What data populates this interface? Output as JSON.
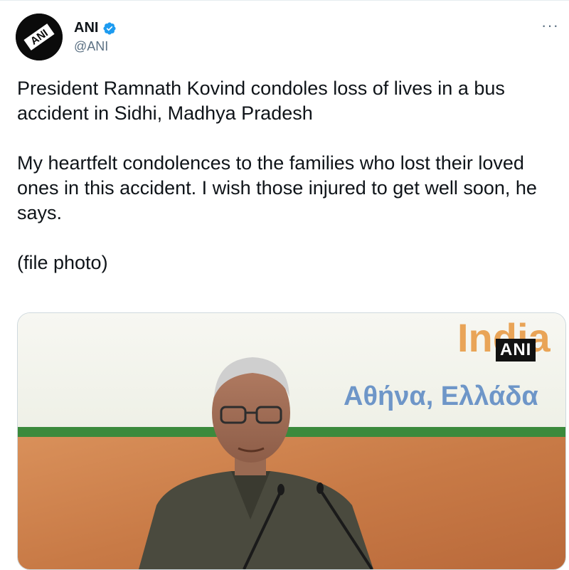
{
  "author": {
    "name": "ANI",
    "handle": "@ANI",
    "avatar_text": "ANI"
  },
  "icons": {
    "verified": "verified-badge-icon",
    "more": "more-options-icon"
  },
  "more_label": "···",
  "tweet": {
    "paragraphs": [
      "President Ramnath Kovind condoles loss of lives in a bus accident in Sidhi, Madhya Pradesh",
      "My heartfelt condolences to the families who lost their loved ones in this accident. I wish those injured to get well soon, he says.",
      "(file photo)"
    ]
  },
  "media": {
    "watermark": "ANI",
    "banner_text": "India",
    "banner_subtext": "Αθήνα, Ελλάδα"
  },
  "colors": {
    "verified": "#1d9bf0",
    "banner_orange": "#e9a457",
    "banner_blue": "#6e96c8",
    "stripe_green": "#3b8a3c"
  }
}
